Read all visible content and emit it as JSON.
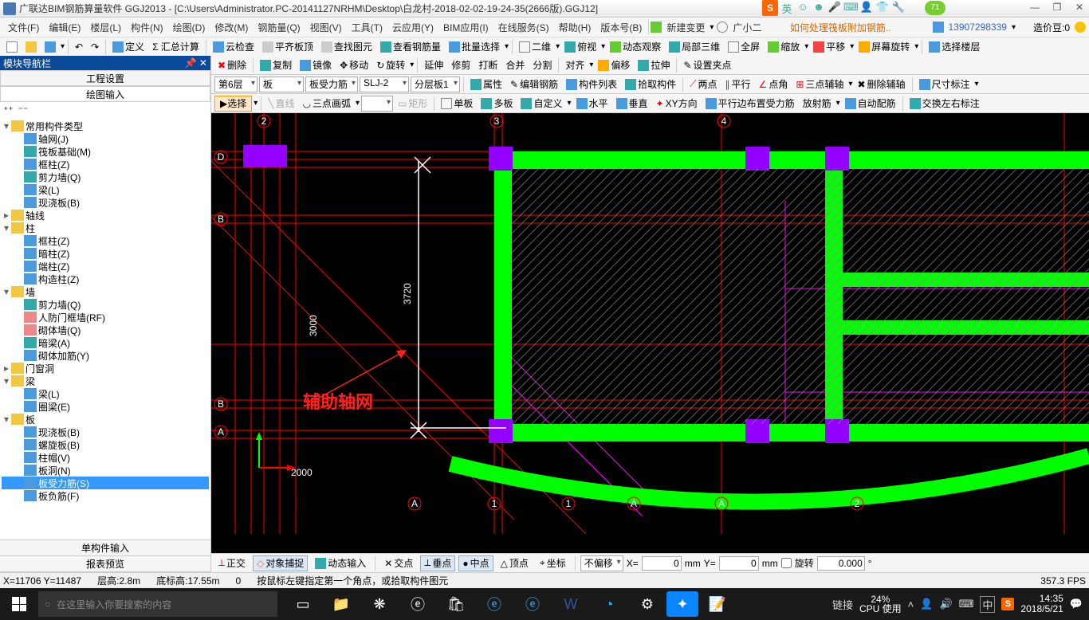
{
  "title": "广联达BIM钢筋算量软件 GGJ2013 - [C:\\Users\\Administrator.PC-20141127NRHM\\Desktop\\白龙村-2018-02-02-19-24-35(2666版).GGJ12]",
  "ime_badge": "71",
  "menu": [
    "文件(F)",
    "编辑(E)",
    "楼层(L)",
    "构件(N)",
    "绘图(D)",
    "修改(M)",
    "钢筋量(Q)",
    "视图(V)",
    "工具(T)",
    "云应用(Y)",
    "BIM应用(I)",
    "在线服务(S)",
    "帮助(H)",
    "版本号(B)"
  ],
  "new_change": "新建变更",
  "agent": "广小二",
  "orange_link": "如何处理筏板附加钢筋..",
  "user_phone": "13907298339",
  "bean_label": "造价豆:0",
  "toolbar1": {
    "define": "定义",
    "sumcalc": "Σ 汇总计算",
    "cloudcheck": "云检查",
    "flatroof": "平齐板顶",
    "lookpic": "查找图元",
    "lookrebar": "查看钢筋量",
    "batchsel": "批量选择",
    "d2": "二维",
    "overlook": "俯视",
    "dynview": "动态观察",
    "local3d": "局部三维",
    "fullscreen": "全屏",
    "zoom": "缩放",
    "pan": "平移",
    "screenrot": "屏幕旋转",
    "sellayer": "选择楼层"
  },
  "toolbar2": {
    "del": "删除",
    "copy": "复制",
    "mirror": "镜像",
    "move": "移动",
    "rotate": "旋转",
    "extend": "延伸",
    "trim": "修剪",
    "break": "打断",
    "merge": "合并",
    "split": "分割",
    "align": "对齐",
    "offset": "偏移",
    "stretch": "拉伸",
    "setgrip": "设置夹点"
  },
  "toolbar3": {
    "floor": "第6层",
    "comp": "板",
    "subcomp": "板受力筋",
    "name": "SLJ-2",
    "floorplate": "分层板1",
    "attr": "属性",
    "editrebar": "编辑钢筋",
    "complist": "构件列表",
    "pickcomp": "拾取构件",
    "twopoint": "两点",
    "parallel": "平行",
    "pointangle": "点角",
    "threeaux": "三点辅轴",
    "delaux": "删除辅轴",
    "dimnote": "尺寸标注"
  },
  "toolbar4": {
    "select": "选择",
    "line": "直线",
    "arc3": "三点画弧",
    "rect": "矩形",
    "single": "单板",
    "multi": "多板",
    "custom": "自定义",
    "horiz": "水平",
    "vert": "垂直",
    "xydir": "XY方向",
    "parallelplace": "平行边布置受力筋",
    "radial": "放射筋",
    "autoplace": "自动配筋",
    "swaplr": "交换左右标注"
  },
  "nav": {
    "header": "模块导航栏",
    "tab1": "工程设置",
    "tab2": "绘图输入"
  },
  "tree": {
    "common": "常用构件类型",
    "common_items": [
      "轴网(J)",
      "筏板基础(M)",
      "框柱(Z)",
      "剪力墙(Q)",
      "梁(L)",
      "现浇板(B)"
    ],
    "axis": "轴线",
    "column": "柱",
    "column_items": [
      "框柱(Z)",
      "暗柱(Z)",
      "端柱(Z)",
      "构造柱(Z)"
    ],
    "wall": "墙",
    "wall_items": [
      "剪力墙(Q)",
      "人防门框墙(RF)",
      "砌体墙(Q)",
      "暗梁(A)",
      "砌体加筋(Y)"
    ],
    "opening": "门窗洞",
    "beam": "梁",
    "beam_items": [
      "梁(L)",
      "圈梁(E)"
    ],
    "slab": "板",
    "slab_items": [
      "现浇板(B)",
      "螺旋板(B)",
      "柱帽(V)",
      "板洞(N)",
      "板受力筋(S)",
      "板负筋(F)"
    ]
  },
  "bottom_tabs": [
    "单构件输入",
    "报表预览"
  ],
  "canvas": {
    "annotation": "辅助轴网",
    "dim1": "3720",
    "dim2": "3000",
    "dim3": "2000",
    "axis_labels": [
      "2",
      "3",
      "4",
      "D",
      "B",
      "B",
      "A",
      "A",
      "1",
      "1",
      "A",
      "2"
    ]
  },
  "status_opts": {
    "ortho": "正交",
    "objsnap": "对象捕捉",
    "dyninput": "动态输入",
    "inter": "交点",
    "perp": "垂点",
    "mid": "中点",
    "vertex": "顶点",
    "coord": "坐标",
    "nooffset": "不偏移",
    "xlabel": "X=",
    "xval": "0",
    "xunit": "mm",
    "ylabel": "Y=",
    "yval": "0",
    "yunit": "mm",
    "rotate": "旋转",
    "angle": "0.000"
  },
  "status": {
    "coords": "X=11706 Y=11487",
    "floor_h": "层高:2.8m",
    "bottom_h": "底标高:17.55m",
    "zero": "0",
    "hint": "按鼠标左键指定第一个角点，或拾取构件图元",
    "fps": "357.3 FPS"
  },
  "taskbar": {
    "search": "在这里输入你要搜索的内容",
    "link": "链接",
    "cpu": "24%",
    "cpu_label": "CPU 使用",
    "ime": "中",
    "time": "14:35",
    "date": "2018/5/21"
  }
}
